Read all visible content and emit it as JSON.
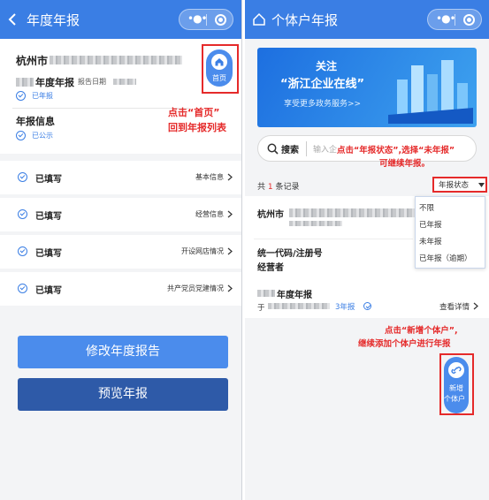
{
  "left": {
    "title": "年度年报",
    "city": "杭州市",
    "year_report_suffix": "年度年报",
    "report_date_label": "报告日期",
    "status_reported": "已年报",
    "info_title": "年报信息",
    "status_public": "已公示",
    "home_label": "首页",
    "rows": [
      {
        "status": "已填写",
        "name": "基本信息"
      },
      {
        "status": "已填写",
        "name": "经营信息"
      },
      {
        "status": "已填写",
        "name": "开设网店情况"
      },
      {
        "status": "已填写",
        "name": "共产党员党建情况"
      }
    ],
    "btn_modify": "修改年度报告",
    "btn_preview": "预览年报",
    "annotation_line1": "点击“首页”",
    "annotation_line2": "回到年报列表"
  },
  "right": {
    "title": "个体户年报",
    "banner_line1": "关注",
    "banner_line2": "“浙江企业在线”",
    "banner_line3": "享受更多政务服务>>",
    "search_label": "搜索",
    "search_placeholder": "输入企",
    "annotation_status_line1": "点击“年报状态”,选择“未年报”",
    "annotation_status_line2": "可继续年报。",
    "count_prefix": "共",
    "count_value": "1",
    "count_suffix": "条记录",
    "filter_label": "年报状态",
    "dropdown_options": [
      "不限",
      "已年报",
      "未年报",
      "已年报（逾期）"
    ],
    "record_city": "杭州市",
    "credit_code_label": "统一代码/注册号",
    "operator_label": "经营者",
    "record_year_title": "年度年报",
    "record_prefix": "于",
    "record_status": "3年报",
    "view_detail": "查看详情",
    "annotation_add_line1": "点击“新增个体户”,",
    "annotation_add_line2": "继续添加个体户进行年报",
    "add_btn_line1": "新增",
    "add_btn_line2": "个体户"
  },
  "colors": {
    "primary": "#3a7ee4",
    "dark_button": "#2e5aa8",
    "annotation": "#e52a2a"
  }
}
